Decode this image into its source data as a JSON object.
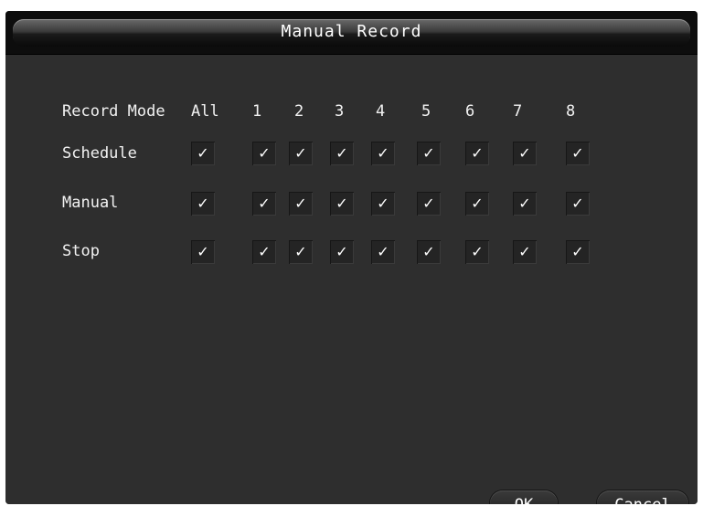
{
  "title": "Manual Record",
  "header": {
    "mode_label": "Record Mode",
    "all_label": "All",
    "channels": [
      "1",
      "2",
      "3",
      "4",
      "5",
      "6",
      "7",
      "8"
    ]
  },
  "rows": [
    {
      "label": "Schedule",
      "checked": [
        true,
        true,
        true,
        true,
        true,
        true,
        true,
        true,
        true
      ]
    },
    {
      "label": "Manual",
      "checked": [
        true,
        true,
        true,
        true,
        true,
        true,
        true,
        true,
        true
      ]
    },
    {
      "label": "Stop",
      "checked": [
        true,
        true,
        true,
        true,
        true,
        true,
        true,
        true,
        true
      ]
    }
  ],
  "check_glyph": "✓",
  "buttons": {
    "ok": "OK",
    "cancel": "Cancel"
  }
}
